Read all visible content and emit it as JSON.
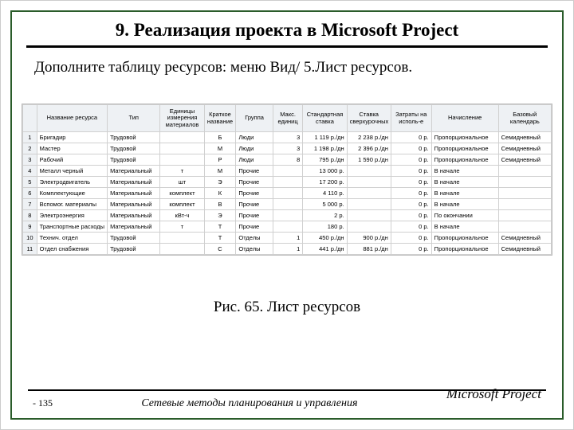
{
  "title": "9. Реализация проекта в Microsoft Project",
  "instruction": "Дополните таблицу ресурсов: меню Вид/ 5.Лист ресурсов.",
  "caption": "Рис. 65. Лист ресурсов",
  "footer": {
    "page": "- 135",
    "center": "Сетевые методы планирования и управления",
    "right": "Microsoft Project"
  },
  "table": {
    "headers": [
      "Название ресурса",
      "Тип",
      "Единицы измерения материалов",
      "Краткое название",
      "Группа",
      "Макс. единиц",
      "Стандартная ставка",
      "Ставка сверхурочных",
      "Затраты на исполь-е",
      "Начисление",
      "Базовый календарь"
    ],
    "rows": [
      {
        "n": "1",
        "name": "Бригадир",
        "type": "Трудовой",
        "unit": "",
        "short": "Б",
        "group": "Люди",
        "max": "3",
        "std": "1 119 р./дн",
        "ovt": "2 238 р./дн",
        "cost": "0 р.",
        "acc": "Пропорциональное",
        "cal": "Семидневный"
      },
      {
        "n": "2",
        "name": "Мастер",
        "type": "Трудовой",
        "unit": "",
        "short": "М",
        "group": "Люди",
        "max": "3",
        "std": "1 198 р./дн",
        "ovt": "2 396 р./дн",
        "cost": "0 р.",
        "acc": "Пропорциональное",
        "cal": "Семидневный"
      },
      {
        "n": "3",
        "name": "Рабочий",
        "type": "Трудовой",
        "unit": "",
        "short": "Р",
        "group": "Люди",
        "max": "8",
        "std": "795 р./дн",
        "ovt": "1 590 р./дн",
        "cost": "0 р.",
        "acc": "Пропорциональное",
        "cal": "Семидневный"
      },
      {
        "n": "4",
        "name": "Металл черный",
        "type": "Материальный",
        "unit": "т",
        "short": "М",
        "group": "Прочие",
        "max": "",
        "std": "13 000 р.",
        "ovt": "",
        "cost": "0 р.",
        "acc": "В начале",
        "cal": ""
      },
      {
        "n": "5",
        "name": "Электродвигатель",
        "type": "Материальный",
        "unit": "шт",
        "short": "Э",
        "group": "Прочие",
        "max": "",
        "std": "17 200 р.",
        "ovt": "",
        "cost": "0 р.",
        "acc": "В начале",
        "cal": ""
      },
      {
        "n": "6",
        "name": "Комплектующие",
        "type": "Материальный",
        "unit": "комплект",
        "short": "К",
        "group": "Прочие",
        "max": "",
        "std": "4 110 р.",
        "ovt": "",
        "cost": "0 р.",
        "acc": "В начале",
        "cal": ""
      },
      {
        "n": "7",
        "name": "Вспомог. материалы",
        "type": "Материальный",
        "unit": "комплект",
        "short": "В",
        "group": "Прочие",
        "max": "",
        "std": "5 000 р.",
        "ovt": "",
        "cost": "0 р.",
        "acc": "В начале",
        "cal": ""
      },
      {
        "n": "8",
        "name": "Электроэнергия",
        "type": "Материальный",
        "unit": "кВт-ч",
        "short": "Э",
        "group": "Прочие",
        "max": "",
        "std": "2 р.",
        "ovt": "",
        "cost": "0 р.",
        "acc": "По окончании",
        "cal": ""
      },
      {
        "n": "9",
        "name": "Транспортные расходы",
        "type": "Материальный",
        "unit": "т",
        "short": "Т",
        "group": "Прочие",
        "max": "",
        "std": "180 р.",
        "ovt": "",
        "cost": "0 р.",
        "acc": "В начале",
        "cal": ""
      },
      {
        "n": "10",
        "name": "Технич. отдел",
        "type": "Трудовой",
        "unit": "",
        "short": "Т",
        "group": "Отделы",
        "max": "1",
        "std": "450 р./дн",
        "ovt": "900 р./дн",
        "cost": "0 р.",
        "acc": "Пропорциональное",
        "cal": "Семидневный"
      },
      {
        "n": "11",
        "name": "Отдел снабжения",
        "type": "Трудовой",
        "unit": "",
        "short": "С",
        "group": "Отделы",
        "max": "1",
        "std": "441 р./дн",
        "ovt": "881 р./дн",
        "cost": "0 р.",
        "acc": "Пропорциональное",
        "cal": "Семидневный"
      }
    ]
  }
}
